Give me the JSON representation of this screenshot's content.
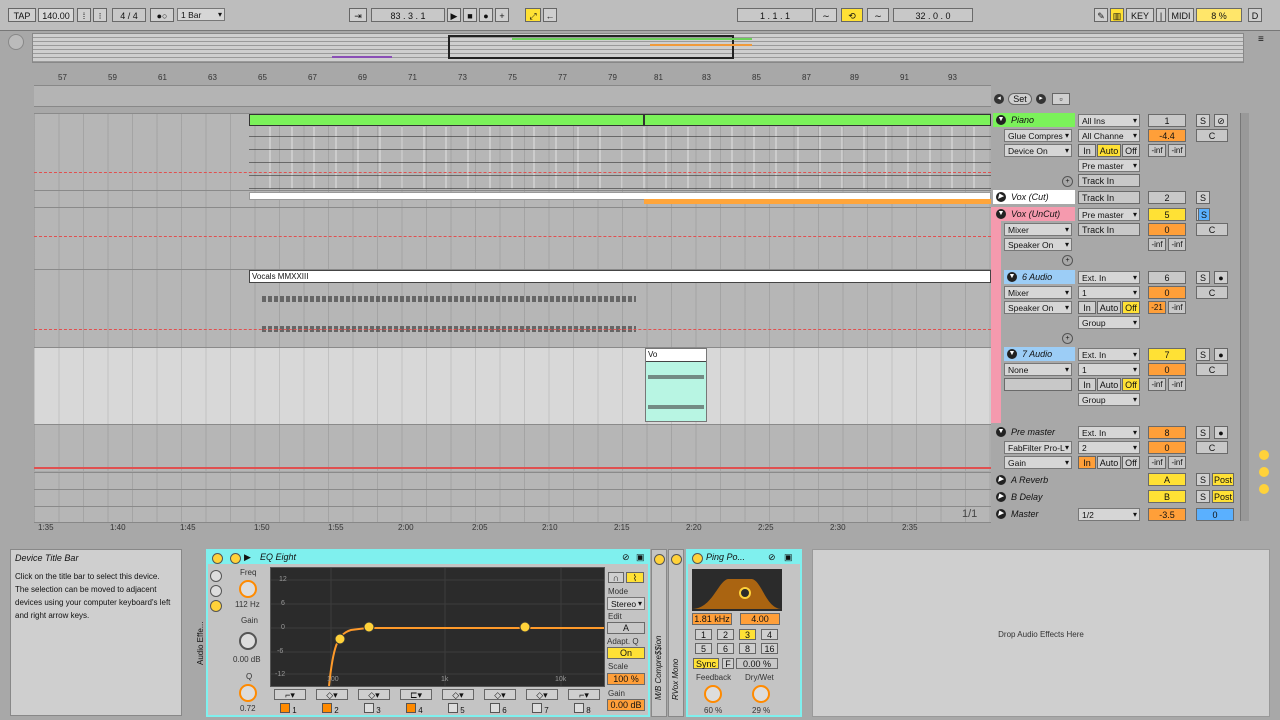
{
  "transport": {
    "tap": "TAP",
    "tempo": "140.00",
    "meter": "4 / 4",
    "quantize": "1 Bar",
    "position": "83 .   3 .   1",
    "loop_start": "1 .   1 .   1",
    "loop_length": "32 .   0 .   0",
    "key": "KEY",
    "midi": "MIDI",
    "cpu": "8 %",
    "d": "D"
  },
  "ruler_top": [
    "57",
    "59",
    "61",
    "63",
    "65",
    "67",
    "69",
    "71",
    "73",
    "75",
    "77",
    "79",
    "81",
    "83",
    "85",
    "87",
    "89",
    "91",
    "93"
  ],
  "ruler_bottom": [
    "1:35",
    "1:40",
    "1:45",
    "1:50",
    "1:55",
    "2:00",
    "2:05",
    "2:10",
    "2:15",
    "2:20",
    "2:25",
    "2:30",
    "2:35"
  ],
  "set_label": "Set",
  "page_indicator": "1/1",
  "clips": {
    "vocals": "Vocals MMXXIII",
    "small": "Vo"
  },
  "tracks": {
    "piano": {
      "name": "Piano",
      "dev1": "Glue Compres",
      "dev2": "Device On",
      "in1": "All Ins",
      "in2": "All Channe",
      "in_monitor": "In",
      "auto": "Auto",
      "off": "Off",
      "out1": "Pre master",
      "out2": "Track In",
      "num": "1",
      "vol": "-4.4",
      "pan": "C",
      "s": "S",
      "sendA": "-inf",
      "sendB": "-inf"
    },
    "vox_cut": {
      "name": "Vox (Cut)",
      "in": "Track In",
      "num": "2",
      "s": "S"
    },
    "vox_uncut": {
      "name": "Vox (UnCut)",
      "dev1": "Mixer",
      "dev2": "Speaker On",
      "out1": "Pre master",
      "out2": "Track In",
      "num": "5",
      "vol": "0",
      "pan": "C",
      "s": "S",
      "sendA": "-inf",
      "sendB": "-inf"
    },
    "audio6": {
      "name": "6 Audio",
      "dev1": "Mixer",
      "dev2": "Speaker On",
      "in1": "Ext. In",
      "in2": "1",
      "in_monitor": "In",
      "auto": "Auto",
      "off": "Off",
      "out1": "Group",
      "num": "6",
      "vol": "0",
      "pan": "C",
      "s": "S",
      "sendA": "-21",
      "sendB": "-inf"
    },
    "audio7": {
      "name": "7 Audio",
      "dev1": "None",
      "in1": "Ext. In",
      "in2": "1",
      "in_monitor": "In",
      "auto": "Auto",
      "off": "Off",
      "out1": "Group",
      "num": "7",
      "vol": "0",
      "pan": "C",
      "s": "S",
      "sendA": "-inf",
      "sendB": "-inf"
    },
    "premaster": {
      "name": "Pre master",
      "dev1": "FabFilter Pro-L",
      "dev2": "Gain",
      "in1": "Ext. In",
      "in2": "2",
      "in_monitor": "In",
      "auto": "Auto",
      "off": "Off",
      "num": "8",
      "vol": "0",
      "pan": "C",
      "s": "S",
      "sendA": "-inf",
      "sendB": "-inf"
    },
    "a_reverb": {
      "name": "A Reverb",
      "num": "A",
      "s": "S",
      "post": "Post"
    },
    "b_delay": {
      "name": "B Delay",
      "num": "B",
      "s": "S",
      "post": "Post"
    },
    "master": {
      "name": "Master",
      "out": "1/2",
      "vol": "-3.5",
      "pan": "0"
    }
  },
  "info": {
    "title": "Device Title Bar",
    "text": "Click on the title bar to select this device. The selection can be moved to adjacent devices using your computer keyboard's left and right arrow keys."
  },
  "eq": {
    "title": "EQ Eight",
    "freq_label": "Freq",
    "freq_value": "112 Hz",
    "gain_label": "Gain",
    "gain_value": "0.00 dB",
    "q_label": "Q",
    "q_value": "0.72",
    "mode_label": "Mode",
    "mode_value": "Stereo",
    "edit_label": "Edit",
    "edit_value": "A",
    "adapt_label": "Adapt. Q",
    "adapt_value": "On",
    "scale_label": "Scale",
    "scale_value": "100 %",
    "gain2_label": "Gain",
    "gain2_value": "0.00 dB",
    "side_label": "Audio Effe...",
    "db_ticks": [
      "12",
      "6",
      "0",
      "-6",
      "-12"
    ],
    "freq_ticks": [
      "100",
      "1k",
      "10k"
    ],
    "bands": [
      "1",
      "2",
      "3",
      "4",
      "5",
      "6",
      "7",
      "8"
    ]
  },
  "vertical_labels": {
    "multiband": "M/B Compre$$ion",
    "rvox": "RVox Mono"
  },
  "ping": {
    "title": "Ping Po...",
    "freq": "1.81 kHz",
    "q": "4.00",
    "grid": [
      "1",
      "2",
      "3",
      "4",
      "5",
      "6",
      "8",
      "16"
    ],
    "sync": "Sync",
    "f": "F",
    "pct": "0.00 %",
    "feedback_label": "Feedback",
    "feedback_value": "60 %",
    "drywet_label": "Dry/Wet",
    "drywet_value": "29 %"
  },
  "drop": "Drop Audio Effects Here"
}
